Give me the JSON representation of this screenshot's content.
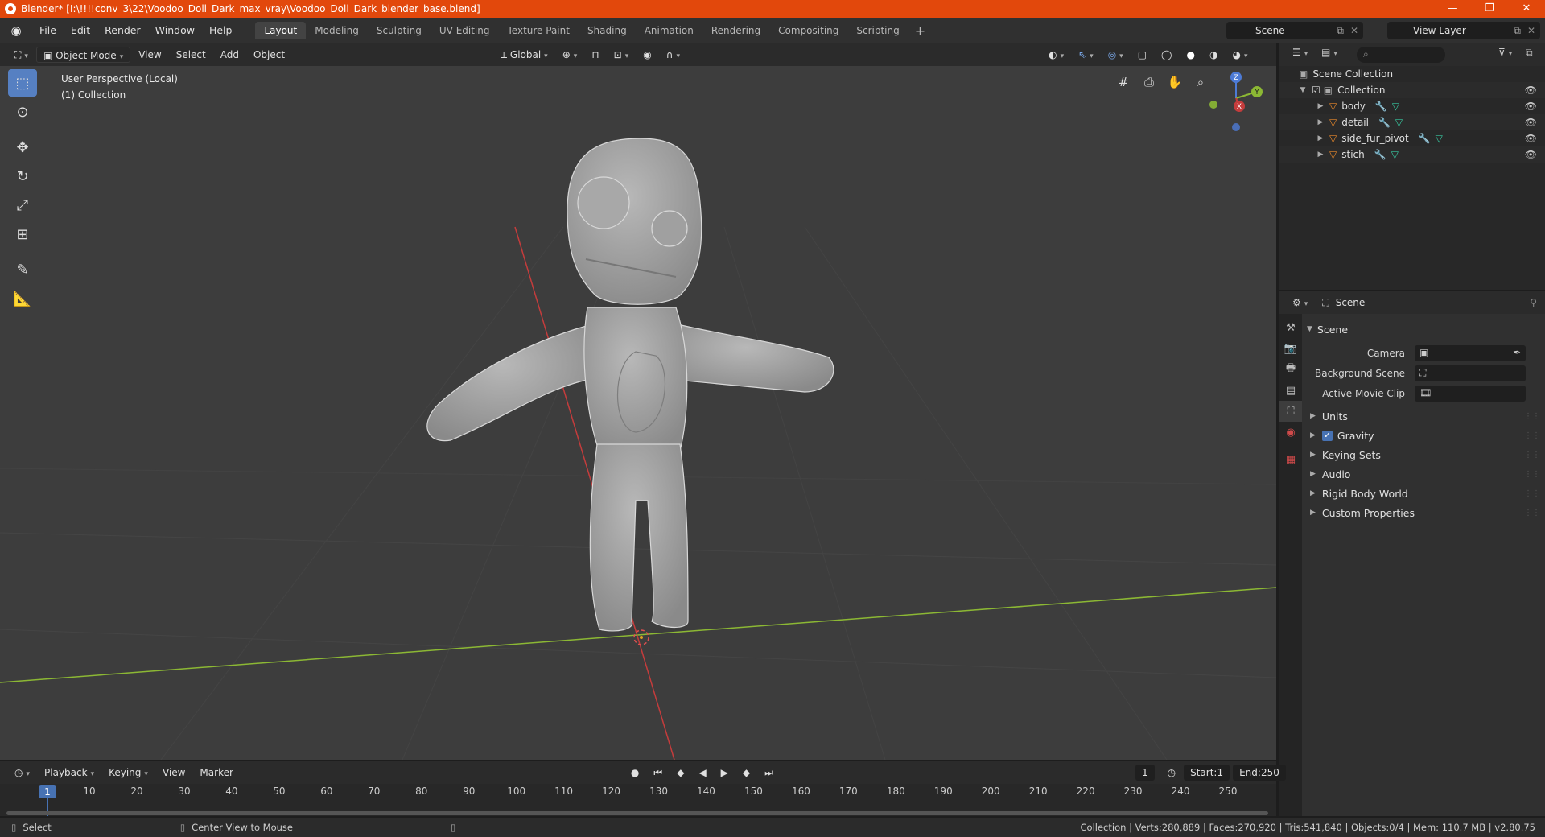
{
  "window": {
    "title": "Blender* [I:\\!!!!conv_3\\22\\Voodoo_Doll_Dark_max_vray\\Voodoo_Doll_Dark_blender_base.blend]",
    "controls": [
      "—",
      "❐",
      "✕"
    ]
  },
  "menu": {
    "items": [
      "File",
      "Edit",
      "Render",
      "Window",
      "Help"
    ],
    "workspaces": [
      "Layout",
      "Modeling",
      "Sculpting",
      "UV Editing",
      "Texture Paint",
      "Shading",
      "Animation",
      "Rendering",
      "Compositing",
      "Scripting"
    ],
    "active_workspace": "Layout",
    "add_label": "+",
    "scene": "Scene",
    "view_layer": "View Layer"
  },
  "viewport_header": {
    "mode": "Object Mode",
    "menus": [
      "View",
      "Select",
      "Add",
      "Object"
    ],
    "orientation": "Global"
  },
  "viewport": {
    "perspective": "User Perspective (Local)",
    "collection": "(1) Collection",
    "gizmo_axes": [
      "Z",
      "X",
      "Y"
    ]
  },
  "toolbar": {
    "tools": [
      "select-box",
      "cursor",
      "move",
      "rotate",
      "scale",
      "transform",
      "annotate",
      "measure"
    ]
  },
  "outliner": {
    "root": "Scene Collection",
    "collection": "Collection",
    "objects": [
      "body",
      "detail",
      "side_fur_pivot",
      "stich"
    ]
  },
  "properties": {
    "context": "Scene",
    "panel": "Scene",
    "rows": [
      {
        "label": "Camera"
      },
      {
        "label": "Background Scene"
      },
      {
        "label": "Active Movie Clip"
      }
    ],
    "subpanels": [
      "Units",
      "Gravity",
      "Keying Sets",
      "Audio",
      "Rigid Body World",
      "Custom Properties"
    ],
    "gravity_checked": true
  },
  "timeline": {
    "menus": [
      "Playback",
      "Keying",
      "View",
      "Marker"
    ],
    "current_frame": "1",
    "start_label": "Start:",
    "start": "1",
    "end_label": "End:",
    "end": "250",
    "ticks": [
      "1",
      "10",
      "20",
      "30",
      "40",
      "50",
      "60",
      "70",
      "80",
      "90",
      "100",
      "110",
      "120",
      "130",
      "140",
      "150",
      "160",
      "170",
      "180",
      "190",
      "200",
      "210",
      "220",
      "230",
      "240",
      "250"
    ]
  },
  "status": {
    "left": "Select",
    "middle": "Center View to Mouse",
    "right": "Collection | Verts:280,889 | Faces:270,920 | Tris:541,840 | Objects:0/4 | Mem: 110.7 MB | v2.80.75"
  },
  "colors": {
    "title_bar": "#e2480c",
    "accent": "#4772b3",
    "x_axis": "#c43c3c",
    "y_axis": "#8cb834",
    "object_icon": "#e7872b"
  }
}
